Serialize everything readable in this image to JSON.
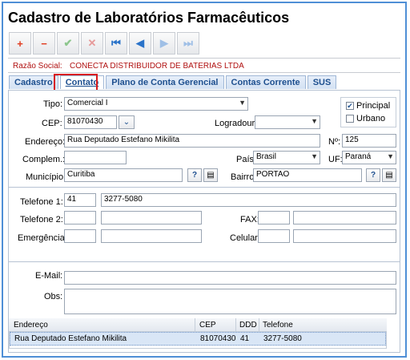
{
  "window": {
    "title": "Cadastro de Laboratórios Farmacêuticos"
  },
  "toolbar": {
    "add": "+",
    "delete": "−",
    "confirm": "✔",
    "cancel": "✕",
    "first": "⏮",
    "prev": "◀",
    "next": "▶",
    "last": "⏭"
  },
  "razao": {
    "label": "Razão Social:",
    "value": "CONECTA DISTRIBUIDOR DE BATERIAS LTDA"
  },
  "tabs": [
    "Cadastro",
    "Contato",
    "Plano de Conta Gerencial",
    "Contas Corrente",
    "SUS"
  ],
  "active_tab": "Contato",
  "form": {
    "tipo_label": "Tipo:",
    "tipo_value": "Comercial I",
    "principal_label": "Principal",
    "principal_checked": true,
    "urbano_label": "Urbano",
    "urbano_checked": false,
    "cep_label": "CEP:",
    "cep_value": "81070430",
    "logradouro_label": "Logradouro:",
    "logradouro_value": "",
    "endereco_label": "Endereço:",
    "endereco_value": "Rua Deputado Estefano Mikilita",
    "numero_label": "Nº:",
    "numero_value": "125",
    "complem_label": "Complem.:",
    "complem_value": "",
    "pais_label": "País:",
    "pais_value": "Brasil",
    "uf_label": "UF:",
    "uf_value": "Paraná",
    "municipio_label": "Município:",
    "municipio_value": "Curitiba",
    "bairro_label": "Bairro:",
    "bairro_value": "PORTAO",
    "lookup_label": "?"
  },
  "phones": {
    "telefone1_label": "Telefone 1:",
    "telefone1_ddd": "41",
    "telefone1_num": "3277-5080",
    "telefone2_label": "Telefone 2:",
    "telefone2_ddd": "",
    "telefone2_num": "",
    "fax_label": "FAX:",
    "fax_ddd": "",
    "fax_num": "",
    "emergencia_label": "Emergência:",
    "emergencia_ddd": "",
    "emergencia_num": "",
    "celular_label": "Celular:",
    "celular_ddd": "",
    "celular_num": ""
  },
  "contact": {
    "email_label": "E-Mail:",
    "email_value": "",
    "obs_label": "Obs:",
    "obs_value": ""
  },
  "grid": {
    "columns": [
      "Endereço",
      "CEP",
      "DDD",
      "Telefone"
    ],
    "rows": [
      [
        "Rua Deputado Estefano Mikilita",
        "81070430",
        "41",
        "3277-5080"
      ]
    ]
  },
  "colors": {
    "accent": "#4f8fd6",
    "highlight": "#d81b1b",
    "razao": "#b01010"
  }
}
